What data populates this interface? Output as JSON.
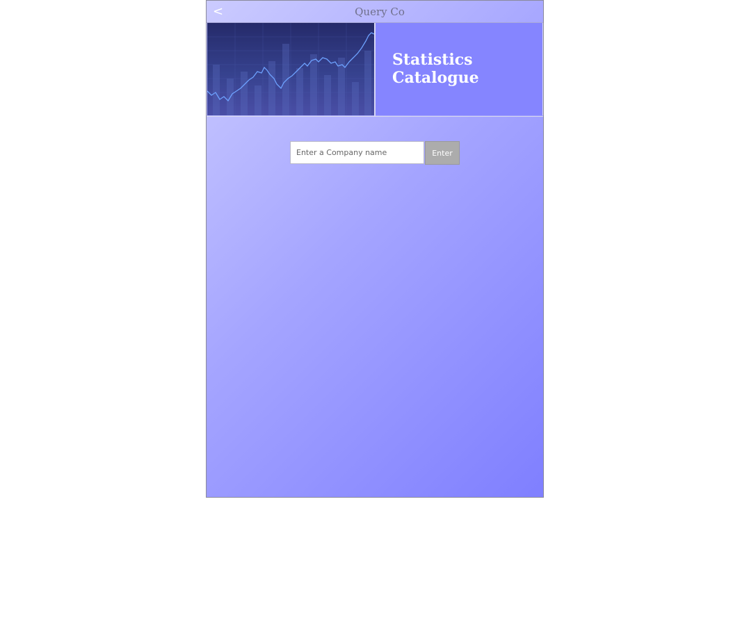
{
  "header": {
    "back_label": "<",
    "title": "Query Co"
  },
  "banner": {
    "image_icon": "stock-chart-image",
    "heading": "Statistics Catalogue"
  },
  "search": {
    "placeholder": "Enter a Company name",
    "value": "",
    "button_label": "Enter"
  },
  "colors": {
    "panel": "#8585ff",
    "gradient_start": "#cbcbff",
    "gradient_end": "#7f7fff",
    "button": "#acacac"
  }
}
